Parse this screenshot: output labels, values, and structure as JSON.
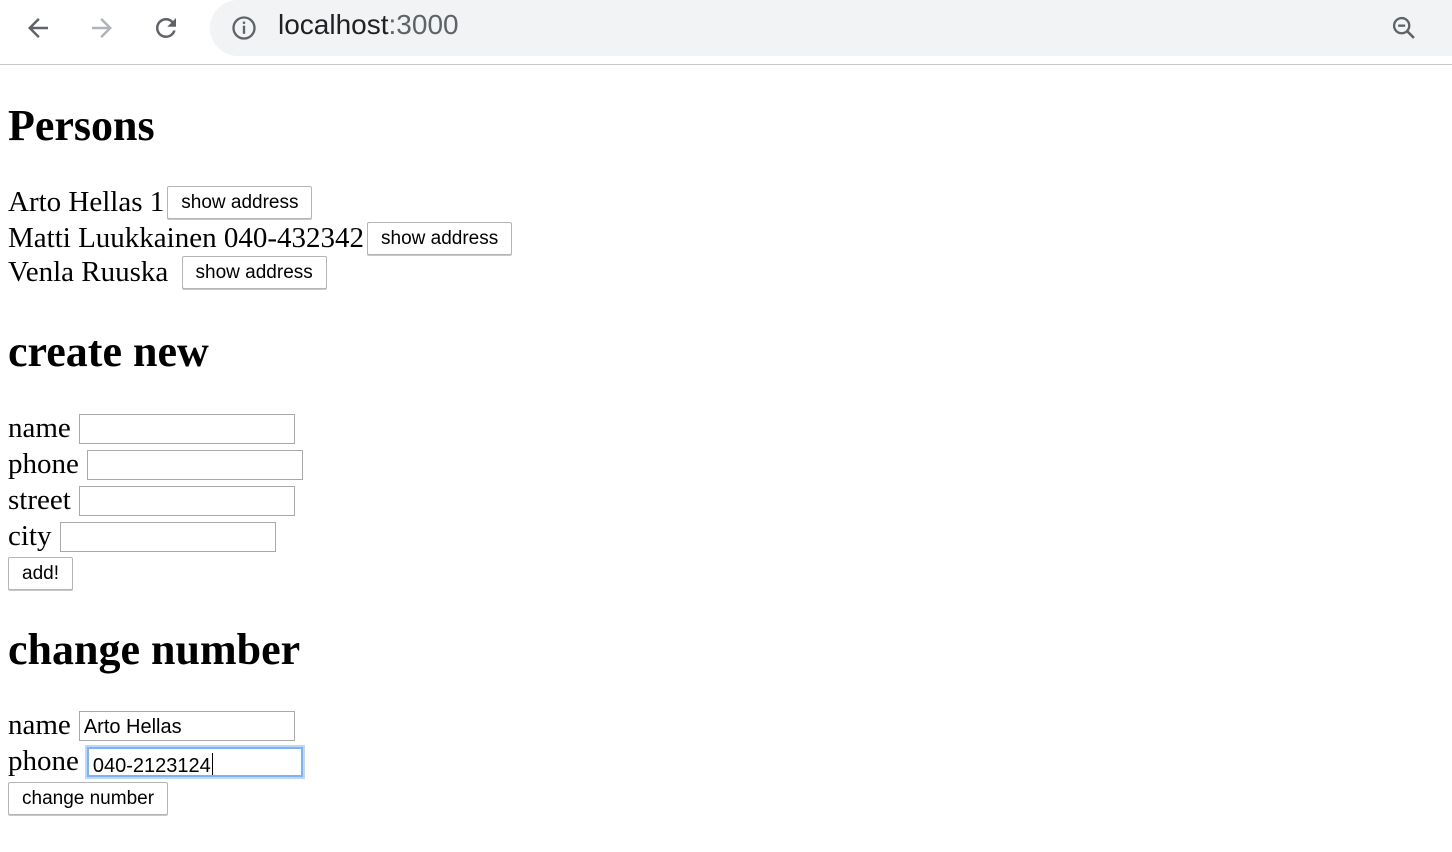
{
  "browser": {
    "url_host": "localhost",
    "url_port": ":3000"
  },
  "persons": {
    "title": "Persons",
    "button_label": "show address",
    "list": [
      {
        "name": "Arto Hellas",
        "phone": "1"
      },
      {
        "name": "Matti Luukkainen",
        "phone": "040-432342"
      },
      {
        "name": "Venla Ruuska",
        "phone": ""
      }
    ]
  },
  "create_new": {
    "title": "create new",
    "fields": [
      {
        "label": "name",
        "value": ""
      },
      {
        "label": "phone",
        "value": ""
      },
      {
        "label": "street",
        "value": ""
      },
      {
        "label": "city",
        "value": ""
      }
    ],
    "submit_label": "add!"
  },
  "change_number": {
    "title": "change number",
    "fields": [
      {
        "label": "name",
        "value": "Arto Hellas"
      },
      {
        "label": "phone",
        "value": "040-2123124"
      }
    ],
    "submit_label": "change number"
  }
}
